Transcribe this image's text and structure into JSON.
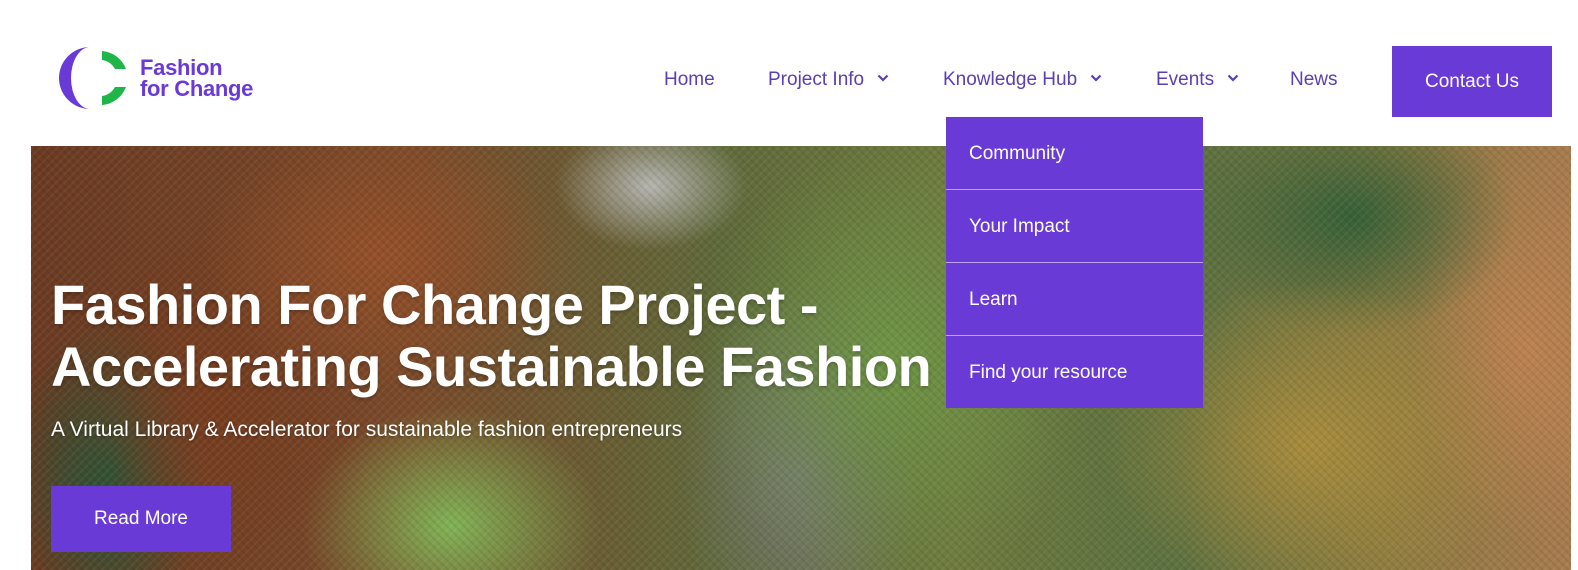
{
  "brand": {
    "name_line1": "Fashion",
    "name_line2": "for Change",
    "logo_icon": "fashion-for-change-logo",
    "colors": {
      "purple": "#6a3ad6",
      "green": "#1fb548",
      "nav_text": "#5a3fb0"
    }
  },
  "nav": {
    "home": "Home",
    "project_info": "Project Info",
    "knowledge_hub": "Knowledge Hub",
    "events": "Events",
    "news": "News",
    "contact": "Contact Us",
    "chevron_icon": "chevron-down-icon"
  },
  "dropdown": {
    "items": [
      {
        "label": "Community"
      },
      {
        "label": "Your Impact"
      },
      {
        "label": "Learn"
      },
      {
        "label": "Find your resource"
      }
    ]
  },
  "hero": {
    "title_line1": "Fashion For Change Project -",
    "title_line2": "Accelerating Sustainable Fashion",
    "subtitle": "A Virtual Library & Accelerator for sustainable fashion entrepreneurs",
    "cta": "Read More"
  }
}
